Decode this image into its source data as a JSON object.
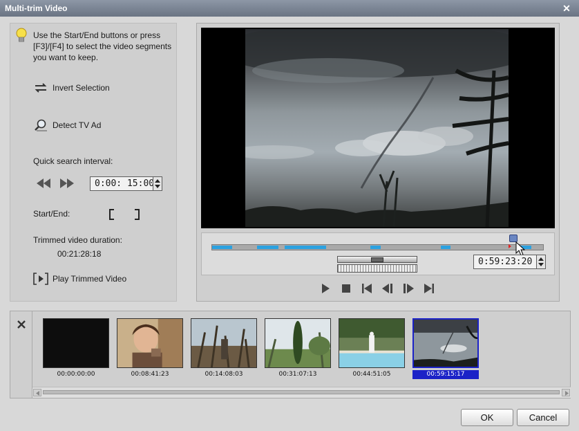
{
  "window": {
    "title": "Multi-trim Video"
  },
  "left": {
    "hint": "Use the Start/End buttons or press [F3]/[F4] to select the video segments you want to keep.",
    "invert_label": "Invert Selection",
    "detect_label": "Detect TV Ad",
    "quick_label": "Quick search interval:",
    "quick_value": "0:00: 15:00",
    "startend_label": "Start/End:",
    "trimmed_label": "Trimmed video duration:",
    "trimmed_value": "00:21:28:18",
    "play_trimmed_label": "Play Trimmed Video"
  },
  "player": {
    "timecode": "0:59:23:20",
    "selected_segments_fraction": [
      [
        0,
        0.06
      ],
      [
        0.135,
        0.2
      ],
      [
        0.22,
        0.345
      ],
      [
        0.478,
        0.51
      ],
      [
        0.69,
        0.72
      ],
      [
        0.93,
        0.965
      ]
    ],
    "playhead_fraction": 0.94
  },
  "thumbnails": [
    {
      "time": "00:00:00:00",
      "scene": "black"
    },
    {
      "time": "00:08:41:23",
      "scene": "person"
    },
    {
      "time": "00:14:08:03",
      "scene": "trees"
    },
    {
      "time": "00:31:07:13",
      "scene": "garden"
    },
    {
      "time": "00:44:51:05",
      "scene": "pool"
    },
    {
      "time": "00:59:15:17",
      "scene": "storm",
      "selected": true
    }
  ],
  "buttons": {
    "ok": "OK",
    "cancel": "Cancel"
  },
  "colors": {
    "selection": "#1b22c7",
    "segment": "#2ba1e0"
  }
}
